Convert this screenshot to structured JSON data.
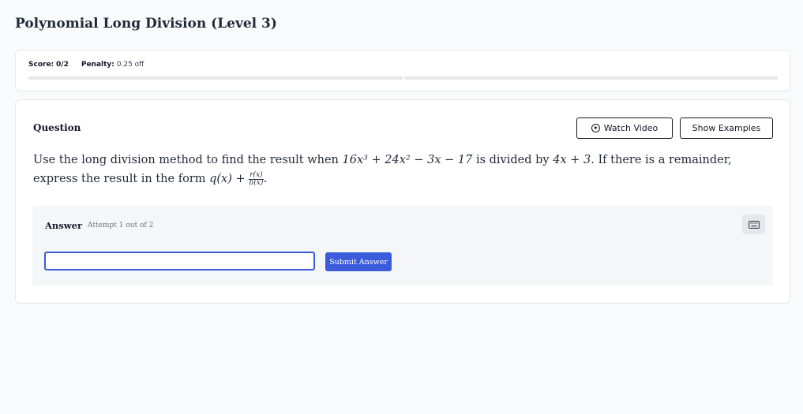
{
  "page": {
    "title": "Polynomial Long Division (Level 3)"
  },
  "score": {
    "score_label": "Score:",
    "score_value": "0/2",
    "penalty_label": "Penalty:",
    "penalty_value": "0.25 off",
    "progress_segments": 2
  },
  "question": {
    "label": "Question",
    "watch_video_label": "Watch Video",
    "show_examples_label": "Show Examples",
    "text_before": "Use the long division method to find the result when",
    "dividend": "16x³ + 24x² − 3x − 17",
    "text_middle": "is divided by",
    "divisor": "4x + 3",
    "text_after": ". If there is a remainder, express the result in the form",
    "form_q": "q(x) +",
    "form_frac_num": "r(x)",
    "form_frac_den": "b(x)",
    "form_end": "."
  },
  "answer": {
    "label": "Answer",
    "attempt": "Attempt 1 out of 2",
    "input_value": "",
    "input_placeholder": "",
    "submit_label": "Submit Answer",
    "keyboard_icon": "keyboard-icon"
  },
  "colors": {
    "accent": "#3b5bdb",
    "background": "#f9fafb",
    "panel": "#f5f6f7"
  }
}
